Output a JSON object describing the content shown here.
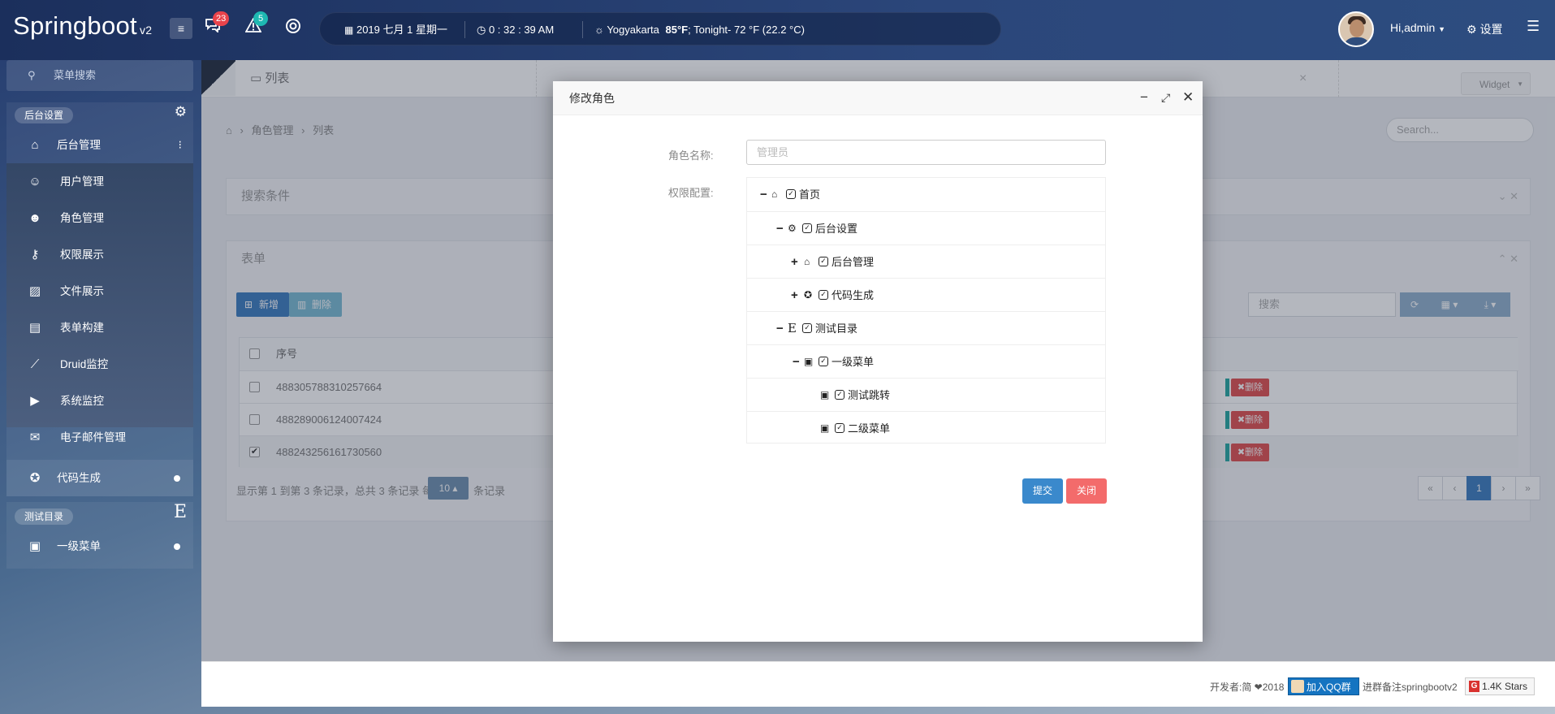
{
  "brand": {
    "name": "Springboot",
    "version": "v2"
  },
  "topbar": {
    "menu_icon": "≡",
    "notifications": {
      "icon": "chat-icon",
      "count": "23"
    },
    "alerts": {
      "icon": "warning-icon",
      "count": "5"
    },
    "help_icon": "lifebuoy-icon",
    "date": "2019 七月 1 星期一",
    "time": "0 : 32 : 39 AM",
    "weather_city": "Yogyakarta",
    "weather_temp": "85°F",
    "weather_tonight": "; Tonight- 72 °F (22.2 °C)",
    "user_greeting": "Hi,admin",
    "settings_label": "设置"
  },
  "sidebar": {
    "search_placeholder": "菜单搜索",
    "group1_label": "后台设置",
    "items": [
      {
        "label": "后台管理",
        "icon": "home-icon"
      },
      {
        "label": "用户管理",
        "icon": "user-icon"
      },
      {
        "label": "角色管理",
        "icon": "users-icon"
      },
      {
        "label": "权限展示",
        "icon": "key-icon"
      },
      {
        "label": "文件展示",
        "icon": "image-icon"
      },
      {
        "label": "表单构建",
        "icon": "list-icon"
      },
      {
        "label": "Druid监控",
        "icon": "chart-line-icon"
      },
      {
        "label": "系统监控",
        "icon": "video-icon"
      },
      {
        "label": "电子邮件管理",
        "icon": "mail-icon"
      },
      {
        "label": "代码生成",
        "icon": "rebel-icon"
      }
    ],
    "group2_label": "测试目录",
    "group2_icon": "E",
    "items2": [
      {
        "label": "一级菜单",
        "icon": "contact-icon"
      }
    ]
  },
  "main": {
    "tab_active": "列表",
    "widget_label": "Widget",
    "breadcrumb": [
      "角色管理",
      "列表"
    ],
    "search_placeholder": "Search...",
    "search_panel_title": "搜索条件",
    "table_panel_title": "表单",
    "btn_add": "新增",
    "btn_delete": "删除",
    "table_search_placeholder": "搜索",
    "column_id": "序号",
    "rows": [
      {
        "id": "488305788310257664",
        "checked": ""
      },
      {
        "id": "488289006124007424",
        "checked": ""
      },
      {
        "id": "488243256161730560",
        "checked": "✔"
      }
    ],
    "row_delete_label": "✖删除",
    "pager_info_prefix": "显示第 1 到第 3 条记录，总共 3 条记录 每页显示",
    "pager_size": "10",
    "pager_info_suffix": "条记录",
    "pages": [
      "«",
      "‹",
      "1",
      "›",
      "»"
    ]
  },
  "modal": {
    "title": "修改角色",
    "name_label": "角色名称:",
    "name_placeholder": "管理员",
    "perm_label": "权限配置:",
    "tree": [
      {
        "toggle": "−",
        "icon": "home-icon",
        "label": "首页"
      },
      {
        "toggle": "−",
        "icon": "gear-icon",
        "label": "后台设置"
      },
      {
        "toggle": "+",
        "icon": "home-icon",
        "label": "后台管理"
      },
      {
        "toggle": "+",
        "icon": "rebel-icon",
        "label": "代码生成"
      },
      {
        "toggle": "−",
        "icon": "E",
        "label": "测试目录"
      },
      {
        "toggle": "−",
        "icon": "contact-icon",
        "label": "一级菜单"
      },
      {
        "toggle": "",
        "icon": "contact-icon",
        "label": "测试跳转"
      },
      {
        "toggle": "",
        "icon": "contact-icon",
        "label": "二级菜单"
      }
    ],
    "submit_label": "提交",
    "close_label": "关闭"
  },
  "footer": {
    "dev_text": "开发者:简 ❤2018",
    "qq_label": "加入QQ群",
    "join_note": "进群备注springbootv2",
    "stars_label": "1.4K Stars"
  }
}
